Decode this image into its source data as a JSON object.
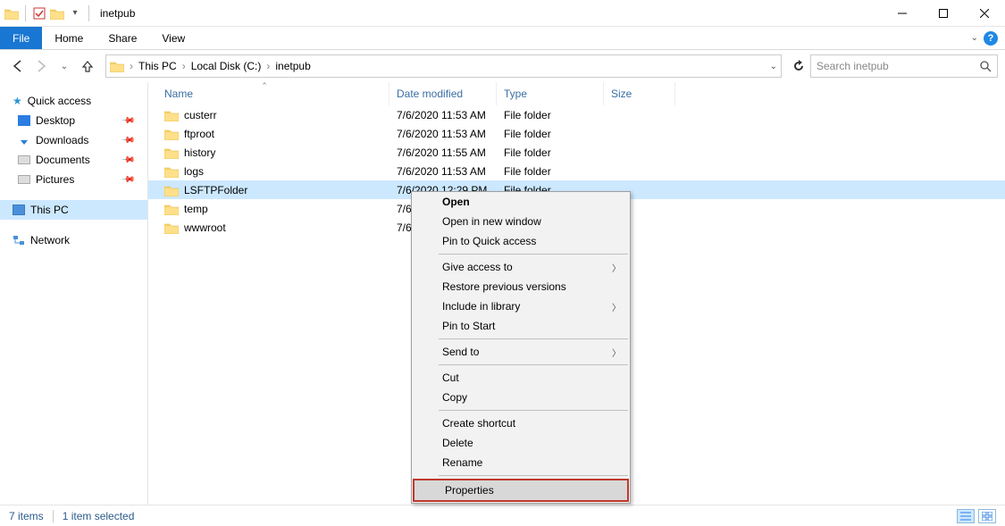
{
  "window": {
    "title": "inetpub"
  },
  "ribbon": {
    "file": "File",
    "tabs": [
      "Home",
      "Share",
      "View"
    ]
  },
  "breadcrumb": {
    "items": [
      "This PC",
      "Local Disk (C:)",
      "inetpub"
    ]
  },
  "search": {
    "placeholder": "Search inetpub"
  },
  "sidebar": {
    "quick_access": "Quick access",
    "quick_items": [
      {
        "label": "Desktop",
        "pinned": true
      },
      {
        "label": "Downloads",
        "pinned": true
      },
      {
        "label": "Documents",
        "pinned": true
      },
      {
        "label": "Pictures",
        "pinned": true
      }
    ],
    "this_pc": "This PC",
    "network": "Network"
  },
  "columns": {
    "name": "Name",
    "date": "Date modified",
    "type": "Type",
    "size": "Size"
  },
  "files": [
    {
      "name": "custerr",
      "date": "7/6/2020 11:53 AM",
      "type": "File folder",
      "selected": false
    },
    {
      "name": "ftproot",
      "date": "7/6/2020 11:53 AM",
      "type": "File folder",
      "selected": false
    },
    {
      "name": "history",
      "date": "7/6/2020 11:55 AM",
      "type": "File folder",
      "selected": false
    },
    {
      "name": "logs",
      "date": "7/6/2020 11:53 AM",
      "type": "File folder",
      "selected": false
    },
    {
      "name": "LSFTPFolder",
      "date": "7/6/2020 12:29 PM",
      "type": "File folder",
      "selected": true
    },
    {
      "name": "temp",
      "date": "7/6/",
      "type": "",
      "selected": false
    },
    {
      "name": "wwwroot",
      "date": "7/6/",
      "type": "",
      "selected": false
    }
  ],
  "context_menu": {
    "open": "Open",
    "open_new": "Open in new window",
    "pin_qa": "Pin to Quick access",
    "give_access": "Give access to",
    "restore": "Restore previous versions",
    "include_lib": "Include in library",
    "pin_start": "Pin to Start",
    "send_to": "Send to",
    "cut": "Cut",
    "copy": "Copy",
    "create_shortcut": "Create shortcut",
    "delete": "Delete",
    "rename": "Rename",
    "properties": "Properties"
  },
  "status": {
    "items": "7 items",
    "selected": "1 item selected"
  }
}
